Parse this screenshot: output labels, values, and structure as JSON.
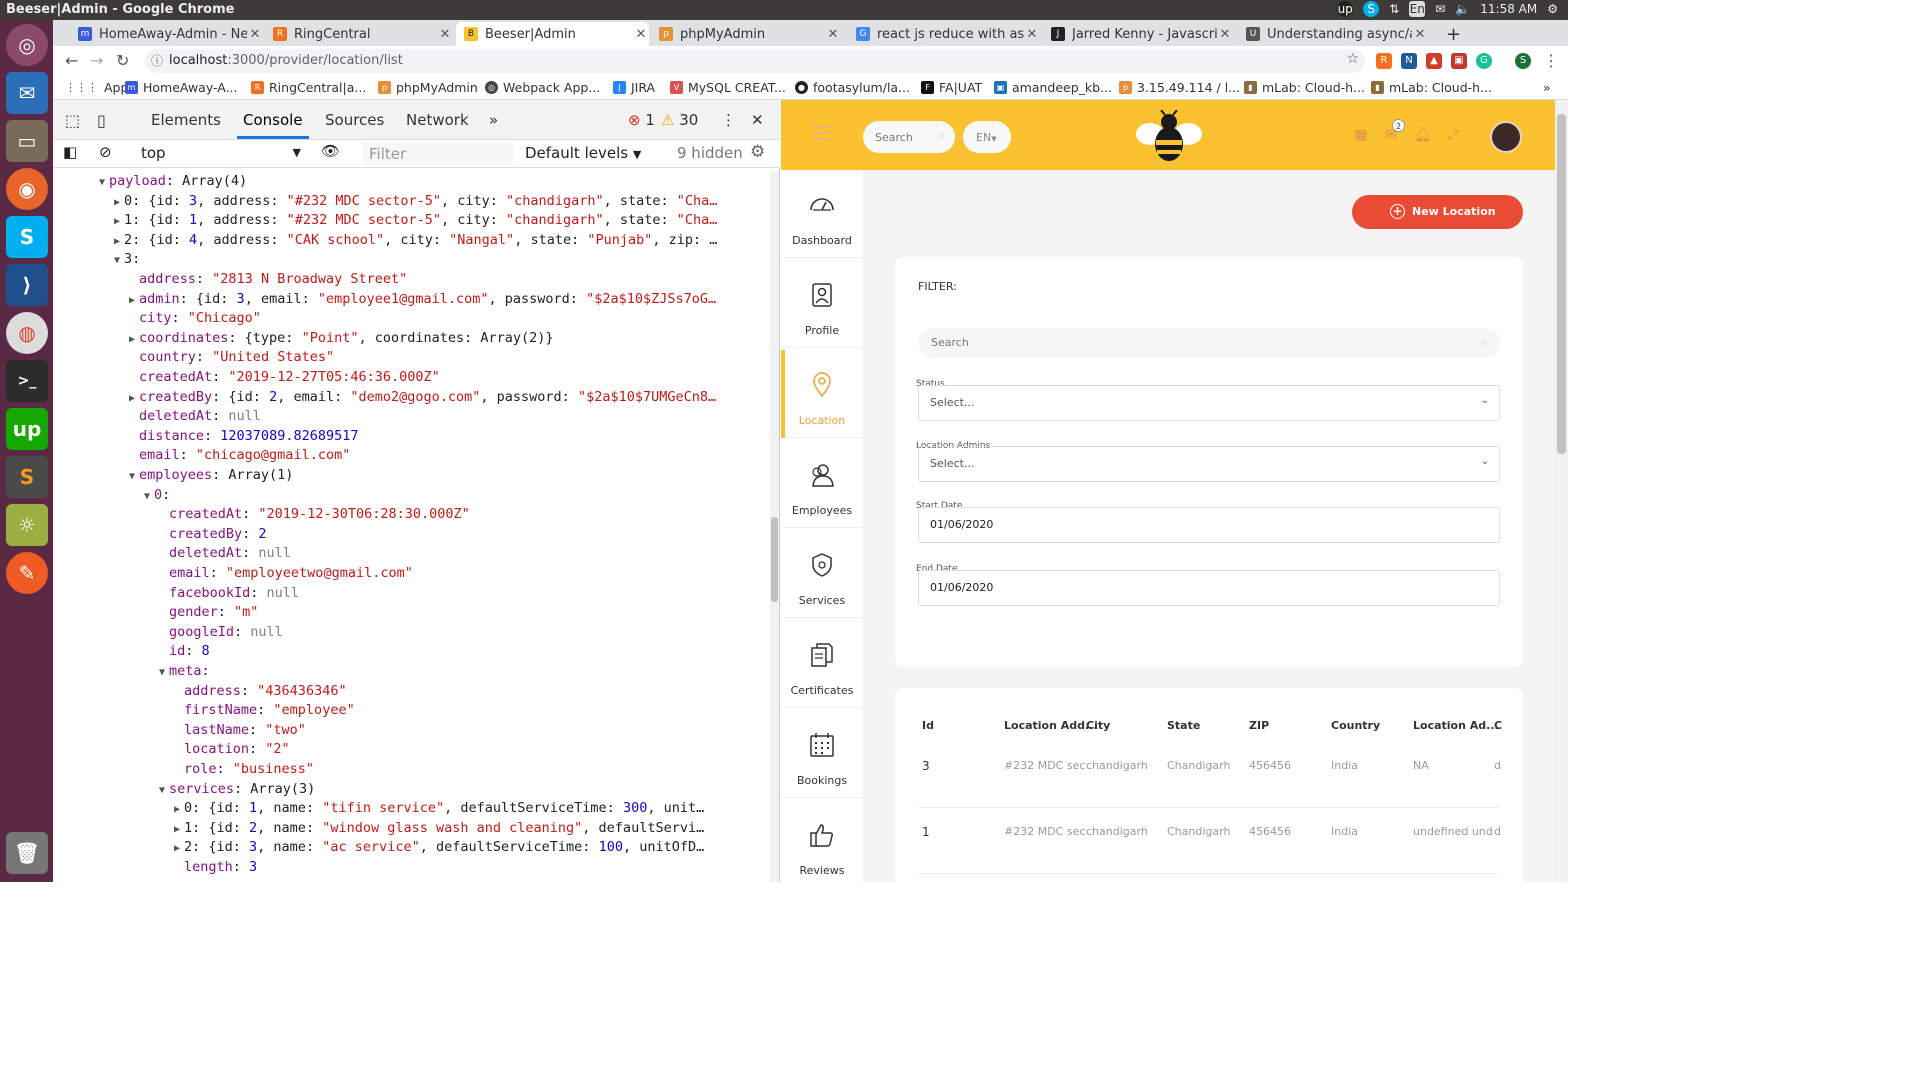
{
  "os": {
    "window_title": "Beeser|Admin - Google Chrome",
    "clock": "11:58 AM",
    "keyboard": "En"
  },
  "browser": {
    "tabs": [
      {
        "label": "HomeAway-Admin - New",
        "color": "#3b5bdb",
        "glyph": "m"
      },
      {
        "label": "RingCentral",
        "color": "#f37021",
        "glyph": "R"
      },
      {
        "label": "Beeser|Admin",
        "color": "#f9c22e",
        "glyph": "B",
        "active": true
      },
      {
        "label": "phpMyAdmin",
        "color": "#e69138",
        "glyph": "p"
      },
      {
        "label": "react js reduce with async",
        "color": "#4285f4",
        "glyph": "G"
      },
      {
        "label": "Jarred Kenny - Javascript",
        "color": "#222222",
        "glyph": "J"
      },
      {
        "label": "Understanding async/aw",
        "color": "#555555",
        "glyph": "U"
      }
    ],
    "url_host": "localhost",
    "url_path": ":3000/provider/location/list",
    "bookmarks": [
      {
        "label": "Apps",
        "color": "#555"
      },
      {
        "label": "HomeAway-A...",
        "color": "#3b5bdb"
      },
      {
        "label": "RingCentral|a...",
        "color": "#f37021"
      },
      {
        "label": "phpMyAdmin",
        "color": "#e69138"
      },
      {
        "label": "Webpack App...",
        "color": "#444"
      },
      {
        "label": "JIRA",
        "color": "#2684ff"
      },
      {
        "label": "MySQL CREAT...",
        "color": "#d9534f"
      },
      {
        "label": "footasylum/la...",
        "color": "#222"
      },
      {
        "label": "FA|UAT",
        "color": "#111"
      },
      {
        "label": "amandeep_kb...",
        "color": "#1e73be"
      },
      {
        "label": "3.15.49.114 / l...",
        "color": "#e69138"
      },
      {
        "label": "mLab: Cloud-h...",
        "color": "#8a6d3b"
      },
      {
        "label": "mLab: Cloud-h...",
        "color": "#8a6d3b"
      }
    ]
  },
  "devtools": {
    "tabs": [
      "Elements",
      "Console",
      "Sources",
      "Network"
    ],
    "errors": "1",
    "warnings": "30",
    "context": "top",
    "filter_placeholder": "Filter",
    "levels": "Default levels",
    "hidden": "9 hidden",
    "lines": [
      {
        "indent": 0,
        "arrow": "▼",
        "html": "<span class='k'>payload</span>: Array(4)"
      },
      {
        "indent": 1,
        "arrow": "▶",
        "html": "0: {id: <span class='n'>3</span>, address: <span class='s'>\"#232 MDC sector-5\"</span>, city: <span class='s'>\"chandigarh\"</span>, state: <span class='s'>\"Cha…</span>"
      },
      {
        "indent": 1,
        "arrow": "▶",
        "html": "1: {id: <span class='n'>1</span>, address: <span class='s'>\"#232 MDC sector-5\"</span>, city: <span class='s'>\"chandigarh\"</span>, state: <span class='s'>\"Cha…</span>"
      },
      {
        "indent": 1,
        "arrow": "▶",
        "html": "2: {id: <span class='n'>4</span>, address: <span class='s'>\"CAK school\"</span>, city: <span class='s'>\"Nangal\"</span>, state: <span class='s'>\"Punjab\"</span>, zip: …"
      },
      {
        "indent": 1,
        "arrow": "▼",
        "html": "3:"
      },
      {
        "indent": 2,
        "arrow": "",
        "html": "<span class='k'>address</span>: <span class='s'>\"2813 N Broadway Street\"</span>"
      },
      {
        "indent": 2,
        "arrow": "▶",
        "html": "<span class='k'>admin</span>: {id: <span class='n'>3</span>, email: <span class='s'>\"employee1@gmail.com\"</span>, password: <span class='s'>\"$2a$10$ZJSs7oG…</span>"
      },
      {
        "indent": 2,
        "arrow": "",
        "html": "<span class='k'>city</span>: <span class='s'>\"Chicago\"</span>"
      },
      {
        "indent": 2,
        "arrow": "▶",
        "html": "<span class='k'>coordinates</span>: {type: <span class='s'>\"Point\"</span>, coordinates: Array(2)}"
      },
      {
        "indent": 2,
        "arrow": "",
        "html": "<span class='k'>country</span>: <span class='s'>\"United States\"</span>"
      },
      {
        "indent": 2,
        "arrow": "",
        "html": "<span class='k'>createdAt</span>: <span class='s'>\"2019-12-27T05:46:36.000Z\"</span>"
      },
      {
        "indent": 2,
        "arrow": "▶",
        "html": "<span class='k'>createdBy</span>: {id: <span class='n'>2</span>, email: <span class='s'>\"demo2@gogo.com\"</span>, password: <span class='s'>\"$2a$10$7UMGeCn8…</span>"
      },
      {
        "indent": 2,
        "arrow": "",
        "html": "<span class='k'>deletedAt</span>: <span class='nul'>null</span>"
      },
      {
        "indent": 2,
        "arrow": "",
        "html": "<span class='k'>distance</span>: <span class='n'>12037089.82689517</span>"
      },
      {
        "indent": 2,
        "arrow": "",
        "html": "<span class='k'>email</span>: <span class='s'>\"chicago@gmail.com\"</span>"
      },
      {
        "indent": 2,
        "arrow": "▼",
        "html": "<span class='k'>employees</span>: Array(1)"
      },
      {
        "indent": 3,
        "arrow": "▼",
        "html": "<span class='k'>0</span>:"
      },
      {
        "indent": 4,
        "arrow": "",
        "html": "<span class='k'>createdAt</span>: <span class='s'>\"2019-12-30T06:28:30.000Z\"</span>"
      },
      {
        "indent": 4,
        "arrow": "",
        "html": "<span class='k'>createdBy</span>: <span class='n'>2</span>"
      },
      {
        "indent": 4,
        "arrow": "",
        "html": "<span class='k'>deletedAt</span>: <span class='nul'>null</span>"
      },
      {
        "indent": 4,
        "arrow": "",
        "html": "<span class='k'>email</span>: <span class='s'>\"employeetwo@gmail.com\"</span>"
      },
      {
        "indent": 4,
        "arrow": "",
        "html": "<span class='k'>facebookId</span>: <span class='nul'>null</span>"
      },
      {
        "indent": 4,
        "arrow": "",
        "html": "<span class='k'>gender</span>: <span class='s'>\"m\"</span>"
      },
      {
        "indent": 4,
        "arrow": "",
        "html": "<span class='k'>googleId</span>: <span class='nul'>null</span>"
      },
      {
        "indent": 4,
        "arrow": "",
        "html": "<span class='k'>id</span>: <span class='n'>8</span>"
      },
      {
        "indent": 4,
        "arrow": "▼",
        "html": "<span class='k'>meta</span>:"
      },
      {
        "indent": 5,
        "arrow": "",
        "html": "<span class='k'>address</span>: <span class='s'>\"436436346\"</span>"
      },
      {
        "indent": 5,
        "arrow": "",
        "html": "<span class='k'>firstName</span>: <span class='s'>\"employee\"</span>"
      },
      {
        "indent": 5,
        "arrow": "",
        "html": "<span class='k'>lastName</span>: <span class='s'>\"two\"</span>"
      },
      {
        "indent": 5,
        "arrow": "",
        "html": "<span class='k'>location</span>: <span class='s'>\"2\"</span>"
      },
      {
        "indent": 5,
        "arrow": "",
        "html": "<span class='k'>role</span>: <span class='s'>\"business\"</span>"
      },
      {
        "indent": 4,
        "arrow": "▼",
        "html": "<span class='k'>services</span>: Array(3)"
      },
      {
        "indent": 5,
        "arrow": "▶",
        "html": "0: {id: <span class='n'>1</span>, name: <span class='s'>\"tifin service\"</span>, defaultServiceTime: <span class='n'>300</span>, unit…"
      },
      {
        "indent": 5,
        "arrow": "▶",
        "html": "1: {id: <span class='n'>2</span>, name: <span class='s'>\"window glass wash and cleaning\"</span>, defaultServi…"
      },
      {
        "indent": 5,
        "arrow": "▶",
        "html": "2: {id: <span class='n'>3</span>, name: <span class='s'>\"ac service\"</span>, defaultServiceTime: <span class='n'>100</span>, unitOfD…"
      },
      {
        "indent": 5,
        "arrow": "",
        "html": "<span class='k'>length</span>: <span class='n'>3</span>"
      }
    ]
  },
  "app": {
    "search_placeholder": "Search",
    "lang": "EN",
    "mail_count": "2",
    "nav": [
      {
        "label": "Dashboard",
        "icon": "gauge-icon"
      },
      {
        "label": "Profile",
        "icon": "profile-icon"
      },
      {
        "label": "Location",
        "icon": "location-pin-icon",
        "active": true
      },
      {
        "label": "Employees",
        "icon": "employees-icon"
      },
      {
        "label": "Services",
        "icon": "services-shield-icon"
      },
      {
        "label": "Certificates",
        "icon": "certificates-icon"
      },
      {
        "label": "Bookings",
        "icon": "calendar-icon"
      },
      {
        "label": "Reviews",
        "icon": "thumbs-up-icon"
      }
    ],
    "new_location_label": "New Location",
    "filter": {
      "title": "FILTER:",
      "search_placeholder": "Search",
      "status_label": "Status",
      "status_value": "Select...",
      "admins_label": "Location Admins",
      "admins_value": "Select...",
      "start_label": "Start Date",
      "start_value": "01/06/2020",
      "end_label": "End Date",
      "end_value": "01/06/2020"
    },
    "table": {
      "headers": [
        "Id",
        "Location Add...",
        "City",
        "State",
        "ZIP",
        "Country",
        "Location Ad...",
        "C"
      ],
      "rows": [
        [
          "3",
          "#232 MDC sect",
          "chandigarh",
          "Chandigarh",
          "456456",
          "India",
          "NA",
          "d"
        ],
        [
          "1",
          "#232 MDC sect",
          "chandigarh",
          "Chandigarh",
          "456456",
          "India",
          "undefined unde",
          "d"
        ]
      ]
    }
  }
}
